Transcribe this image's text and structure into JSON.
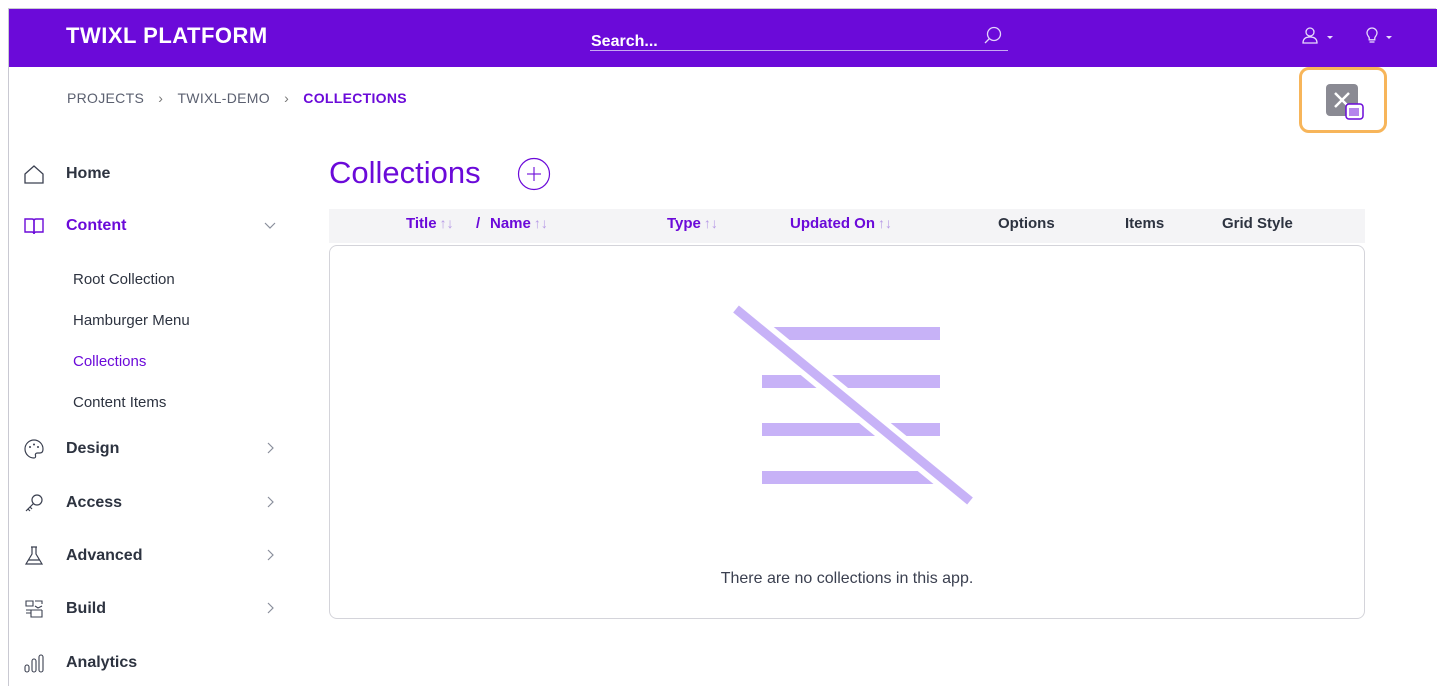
{
  "header": {
    "logo": "TWIXL PLATFORM",
    "search_placeholder": "Search...",
    "icons": [
      "search-icon",
      "user-icon",
      "lightbulb-icon"
    ]
  },
  "breadcrumb": [
    "PROJECTS",
    "TWIXL-DEMO",
    "COLLECTIONS"
  ],
  "sidebar": {
    "items": [
      {
        "label": "Home",
        "icon": "home-icon"
      },
      {
        "label": "Content",
        "icon": "book-icon",
        "expanded": true
      },
      {
        "label": "Design",
        "icon": "palette-icon"
      },
      {
        "label": "Access",
        "icon": "key-icon"
      },
      {
        "label": "Advanced",
        "icon": "flask-icon"
      },
      {
        "label": "Build",
        "icon": "build-icon"
      },
      {
        "label": "Analytics",
        "icon": "bar-chart-icon"
      }
    ],
    "content_sub": [
      "Root Collection",
      "Hamburger Menu",
      "Collections",
      "Content Items"
    ],
    "active_sub": "Collections"
  },
  "main": {
    "title": "Collections",
    "columns": {
      "title": "Title",
      "slash": "/",
      "name": "Name",
      "type": "Type",
      "updated": "Updated On",
      "options": "Options",
      "items": "Items",
      "grid_style": "Grid Style"
    },
    "sort_glyph": "↑↓",
    "empty_message": "There are no collections in this app."
  },
  "colors": {
    "brand": "#6b0ad9",
    "accent_light": "#c7b2f7",
    "highlight": "#f7b55a"
  }
}
